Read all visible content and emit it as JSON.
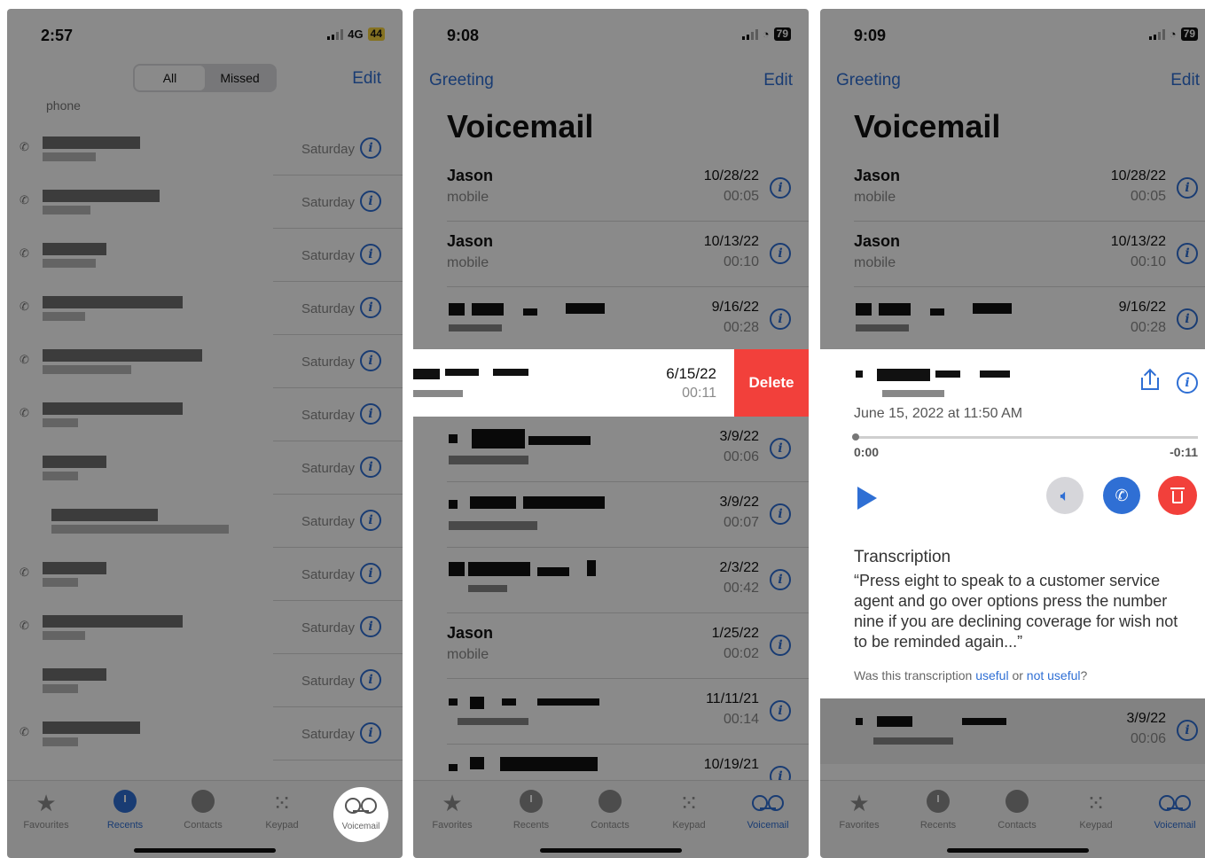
{
  "phone1": {
    "time": "2:57",
    "network": "4G",
    "battery": "44",
    "segments": [
      "All",
      "Missed"
    ],
    "edit": "Edit",
    "phone_label": "phone",
    "rows": [
      {
        "day": "Saturday"
      },
      {
        "day": "Saturday"
      },
      {
        "day": "Saturday"
      },
      {
        "day": "Saturday"
      },
      {
        "day": "Saturday"
      },
      {
        "day": "Saturday"
      },
      {
        "day": "Saturday"
      },
      {
        "day": "Saturday"
      },
      {
        "day": "Saturday"
      },
      {
        "day": "Saturday"
      },
      {
        "day": "Saturday"
      },
      {
        "day": "Saturday"
      }
    ],
    "tabs": [
      "Favourites",
      "Recents",
      "Contacts",
      "Keypad",
      "Voicemail"
    ]
  },
  "phone2": {
    "time": "9:08",
    "battery": "79",
    "greeting": "Greeting",
    "edit": "Edit",
    "title": "Voicemail",
    "items": [
      {
        "name": "Jason",
        "sub": "mobile",
        "date": "10/28/22",
        "dur": "00:05"
      },
      {
        "name": "Jason",
        "sub": "mobile",
        "date": "10/13/22",
        "dur": "00:10"
      },
      {
        "name": "",
        "sub": "",
        "date": "9/16/22",
        "dur": "00:28"
      },
      {
        "name": "",
        "sub": "",
        "date": "6/15/22",
        "dur": "00:11"
      },
      {
        "name": "",
        "sub": "",
        "date": "3/9/22",
        "dur": "00:06"
      },
      {
        "name": "",
        "sub": "",
        "date": "3/9/22",
        "dur": "00:07"
      },
      {
        "name": "",
        "sub": "",
        "date": "2/3/22",
        "dur": "00:42"
      },
      {
        "name": "Jason",
        "sub": "mobile",
        "date": "1/25/22",
        "dur": "00:02"
      },
      {
        "name": "",
        "sub": "",
        "date": "11/11/21",
        "dur": "00:14"
      },
      {
        "name": "",
        "sub": "",
        "date": "10/19/21",
        "dur": ""
      }
    ],
    "delete_label": "Delete",
    "tabs": [
      "Favorites",
      "Recents",
      "Contacts",
      "Keypad",
      "Voicemail"
    ]
  },
  "phone3": {
    "time": "9:09",
    "battery": "79",
    "greeting": "Greeting",
    "edit": "Edit",
    "title": "Voicemail",
    "items": [
      {
        "name": "Jason",
        "sub": "mobile",
        "date": "10/28/22",
        "dur": "00:05"
      },
      {
        "name": "Jason",
        "sub": "mobile",
        "date": "10/13/22",
        "dur": "00:10"
      },
      {
        "name": "",
        "sub": "",
        "date": "9/16/22",
        "dur": "00:28"
      }
    ],
    "expanded": {
      "datetime": "June 15, 2022 at 11:50 AM",
      "elapsed": "0:00",
      "remaining": "-0:11",
      "transcription_title": "Transcription",
      "transcription": "“Press eight to speak to a customer service agent and go over options press the number nine if you are declining coverage for wish not to be reminded again...”",
      "feedback_prefix": "Was this transcription",
      "useful": "useful",
      "or": "or",
      "not_useful": "not useful",
      "question_mark": "?"
    },
    "after": {
      "date": "3/9/22",
      "dur": "00:06"
    },
    "tabs": [
      "Favorites",
      "Recents",
      "Contacts",
      "Keypad",
      "Voicemail"
    ]
  },
  "colors": {
    "accent": "#2f6fd4",
    "delete": "#f2403b",
    "battery_low": "#f6d33f"
  }
}
